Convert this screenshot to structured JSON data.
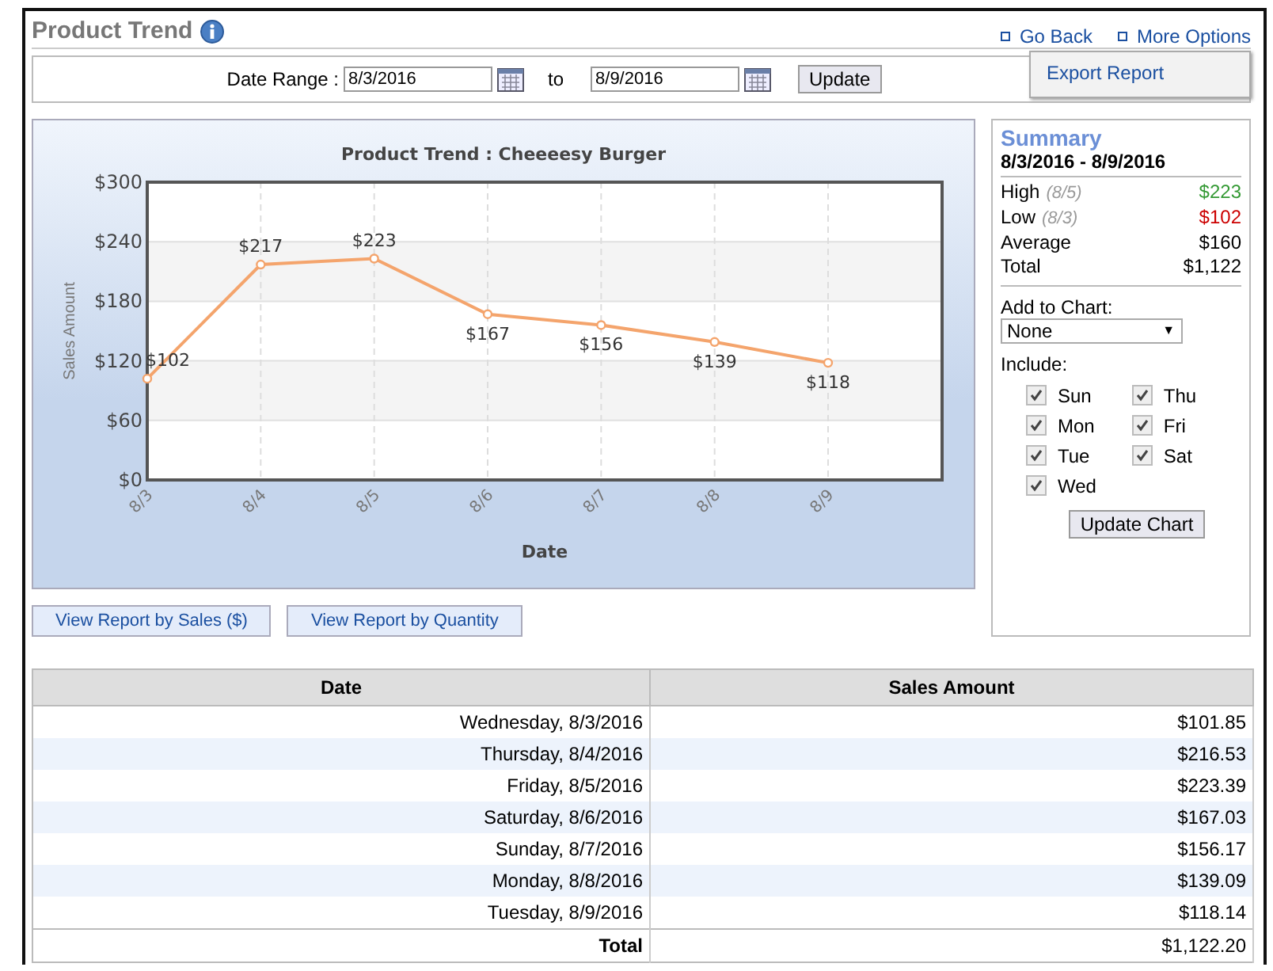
{
  "header": {
    "title": "Product Trend",
    "links": [
      "Go Back",
      "More Options"
    ]
  },
  "menu": {
    "items": [
      "Export Report"
    ]
  },
  "date_range": {
    "label": "Date Range :",
    "from": "8/3/2016",
    "separator": "to",
    "to": "8/9/2016",
    "button": "Update"
  },
  "chart": {
    "chart_data": {
      "type": "line",
      "title": "Product Trend : Cheeeesy Burger",
      "xlabel": "Date",
      "ylabel": "Sales Amount",
      "categories": [
        "8/3",
        "8/4",
        "8/5",
        "8/6",
        "8/7",
        "8/8",
        "8/9"
      ],
      "grid": true,
      "series": [
        {
          "color": "#f4a46c",
          "marker": "circle",
          "values": [
            102,
            217,
            223,
            167,
            156,
            139,
            118
          ]
        }
      ],
      "ylim": [
        0,
        300
      ],
      "yticks": [
        {
          "value": 0,
          "label": "$0"
        },
        {
          "value": 60,
          "label": "$60"
        },
        {
          "value": 120,
          "label": "$120"
        },
        {
          "value": 180,
          "label": "$180"
        },
        {
          "value": 240,
          "label": "$240"
        },
        {
          "value": 300,
          "label": "$300"
        }
      ],
      "value_labels": [
        "$102",
        "$217",
        "$223",
        "$167",
        "$156",
        "$139",
        "$118"
      ]
    }
  },
  "view_buttons": [
    "View Report by Sales ($)",
    "View Report by Quantity"
  ],
  "summary": {
    "title": "Summary",
    "range": "8/3/2016 - 8/9/2016",
    "stats": [
      {
        "label": "High",
        "note": "(8/5)",
        "value": "$223",
        "color": "#339933"
      },
      {
        "label": "Low",
        "note": "(8/3)",
        "value": "$102",
        "color": "#cc0000"
      },
      {
        "label": "Average",
        "value": "$160",
        "color": "#000000"
      },
      {
        "label": "Total",
        "value": "$1,122",
        "color": "#000000"
      }
    ],
    "add_label": "Add to Chart:",
    "add_value": "None",
    "add_caret": "▼",
    "include_label": "Include:",
    "days": [
      {
        "label": "Sun",
        "checked": true
      },
      {
        "label": "Mon",
        "checked": true
      },
      {
        "label": "Tue",
        "checked": true
      },
      {
        "label": "Wed",
        "checked": true
      },
      {
        "label": "Thu",
        "checked": true
      },
      {
        "label": "Fri",
        "checked": true
      },
      {
        "label": "Sat",
        "checked": true
      }
    ],
    "button": "Update Chart"
  },
  "table": {
    "columns": [
      "Date",
      "Sales Amount"
    ],
    "rows": [
      [
        "Wednesday, 8/3/2016",
        "$101.85"
      ],
      [
        "Thursday, 8/4/2016",
        "$216.53"
      ],
      [
        "Friday, 8/5/2016",
        "$223.39"
      ],
      [
        "Saturday, 8/6/2016",
        "$167.03"
      ],
      [
        "Sunday, 8/7/2016",
        "$156.17"
      ],
      [
        "Monday, 8/8/2016",
        "$139.09"
      ],
      [
        "Tuesday, 8/9/2016",
        "$118.14"
      ]
    ],
    "total": [
      "Total",
      "$1,122.20"
    ]
  }
}
